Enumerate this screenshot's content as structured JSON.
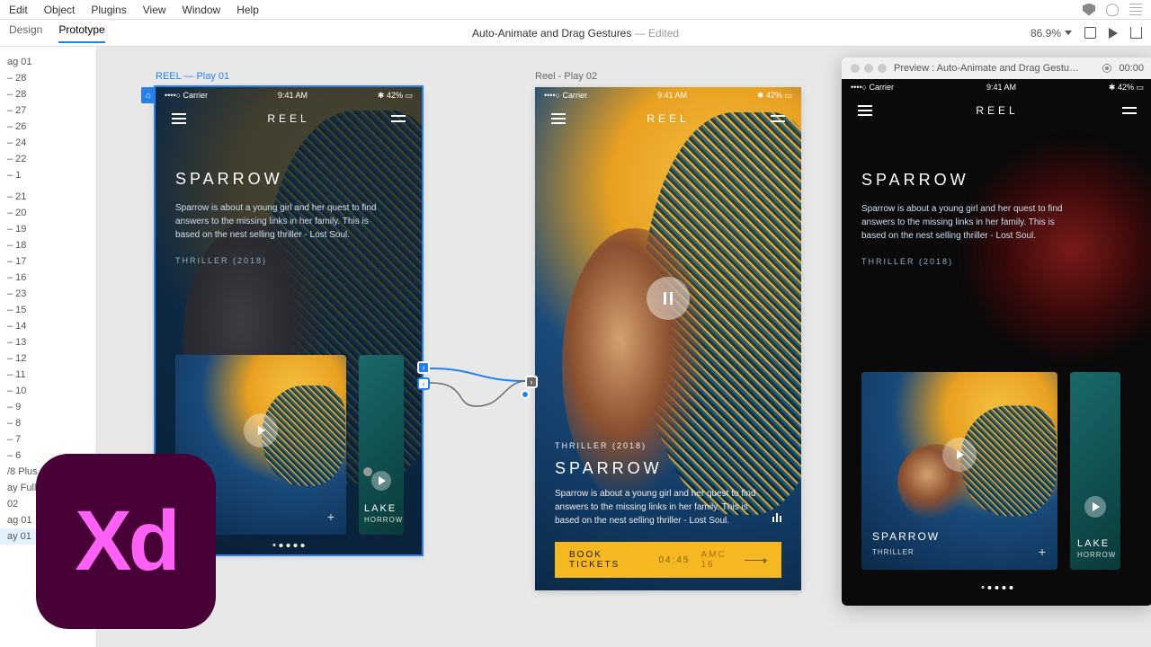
{
  "menubar": {
    "items": [
      "Edit",
      "Object",
      "Plugins",
      "View",
      "Window",
      "Help"
    ]
  },
  "toolbar": {
    "tabs": {
      "design": "Design",
      "prototype": "Prototype"
    },
    "doc_title": "Auto-Animate and Drag Gestures",
    "edited": "—  Edited",
    "zoom": "86.9%"
  },
  "layers": [
    "ag 01",
    " – 28",
    " – 28",
    " – 27",
    " – 26",
    " – 24",
    " – 22",
    " – 1",
    "",
    "  – 21",
    " – 20",
    " – 19",
    " – 18",
    " – 17",
    " – 16",
    " – 23",
    " – 15",
    " – 14",
    " – 13",
    " – 12",
    " – 11",
    " – 10",
    " – 9",
    " – 8",
    " – 7",
    " – 6",
    "/8 Plus – 29",
    "ay Full Scree",
    " 02",
    "ag 01",
    "ay 01"
  ],
  "artboard1": {
    "label": "REEL — Play 01",
    "status": {
      "carrier": "••••○ Carrier",
      "wifi": "ᯤ",
      "time": "9:41 AM",
      "bt": "✱ 42% ▭"
    },
    "app_title": "REEL",
    "headline": "SPARROW",
    "desc": "Sparrow is about a young girl and her quest to find answers to the missing links in her family. This is based on the nest selling thriller - Lost Soul.",
    "meta": "THRILLER (2018)",
    "card1": {
      "title": "ROW",
      "meta": "LER",
      "plus": "+"
    },
    "card2": {
      "title": "LAKE",
      "meta": "HORROW"
    }
  },
  "artboard2": {
    "label": "Reel - Play 02",
    "status": {
      "carrier": "••••○ Carrier",
      "wifi": "ᯤ",
      "time": "9:41 AM",
      "bt": "✱ 42% ▭"
    },
    "app_title": "REEL",
    "meta": "THRILLER (2018)",
    "headline": "SPARROW",
    "desc": "Sparrow is about a young girl and her quest to find answers to the missing links in her family. This is based on the nest selling thriller - Lost Soul.",
    "book": "BOOK TICKETS",
    "book_time": "04:45",
    "book_amc": "AMC 16"
  },
  "preview": {
    "title": "Preview : Auto-Animate and Drag Gestu…",
    "rec_time": "00:00",
    "status": {
      "carrier": "••••○ Carrier",
      "wifi": "ᯤ",
      "time": "9:41 AM",
      "bt": "✱ 42% ▭"
    },
    "app_title": "REEL",
    "headline": "SPARROW",
    "desc": "Sparrow is about a young girl and her quest to find answers to the missing links in her family. This is based on the nest selling thriller - Lost Soul.",
    "meta": "THRILLER (2018)",
    "card1": {
      "title": "SPARROW",
      "meta": "THRILLER",
      "plus": "+"
    },
    "card2": {
      "title": "LAKE",
      "meta": "HORROW"
    }
  },
  "logo": "Xd"
}
